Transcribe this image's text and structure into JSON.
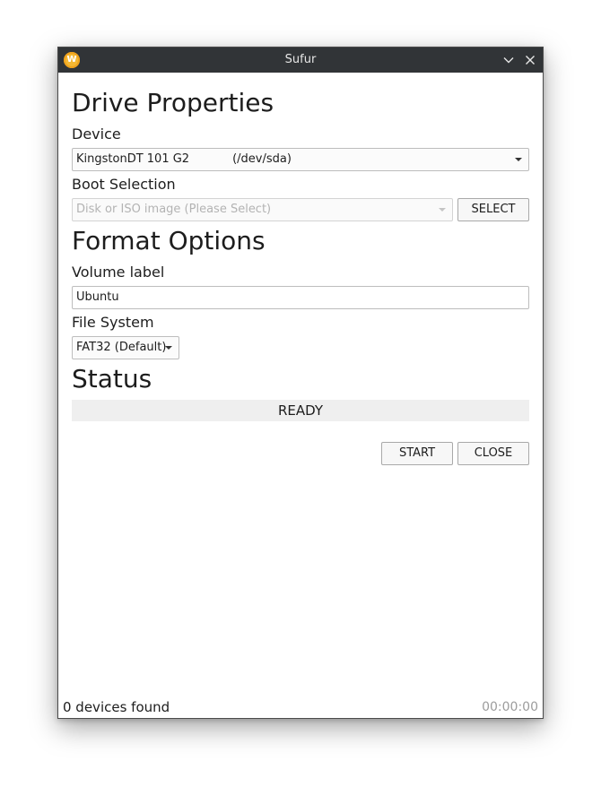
{
  "window": {
    "title": "Sufur",
    "app_icon_letter": "W"
  },
  "drive_properties": {
    "heading": "Drive Properties",
    "device_label": "Device",
    "device_name": "KingstonDT 101 G2",
    "device_path": "(/dev/sda)",
    "boot_label": "Boot Selection",
    "boot_placeholder": "Disk or ISO image (Please Select)",
    "select_button": "SELECT"
  },
  "format_options": {
    "heading": "Format Options",
    "volume_label_label": "Volume label",
    "volume_label_value": "Ubuntu",
    "file_system_label": "File System",
    "file_system_value": "FAT32 (Default)"
  },
  "status": {
    "heading": "Status",
    "text": "READY"
  },
  "actions": {
    "start_button": "START",
    "close_button": "CLOSE"
  },
  "footer": {
    "devices_found": "0 devices found",
    "timer": "00:00:00"
  },
  "colors": {
    "titlebar": "#313437",
    "app_icon": "#f5b833",
    "status_bar": "#efefef"
  }
}
